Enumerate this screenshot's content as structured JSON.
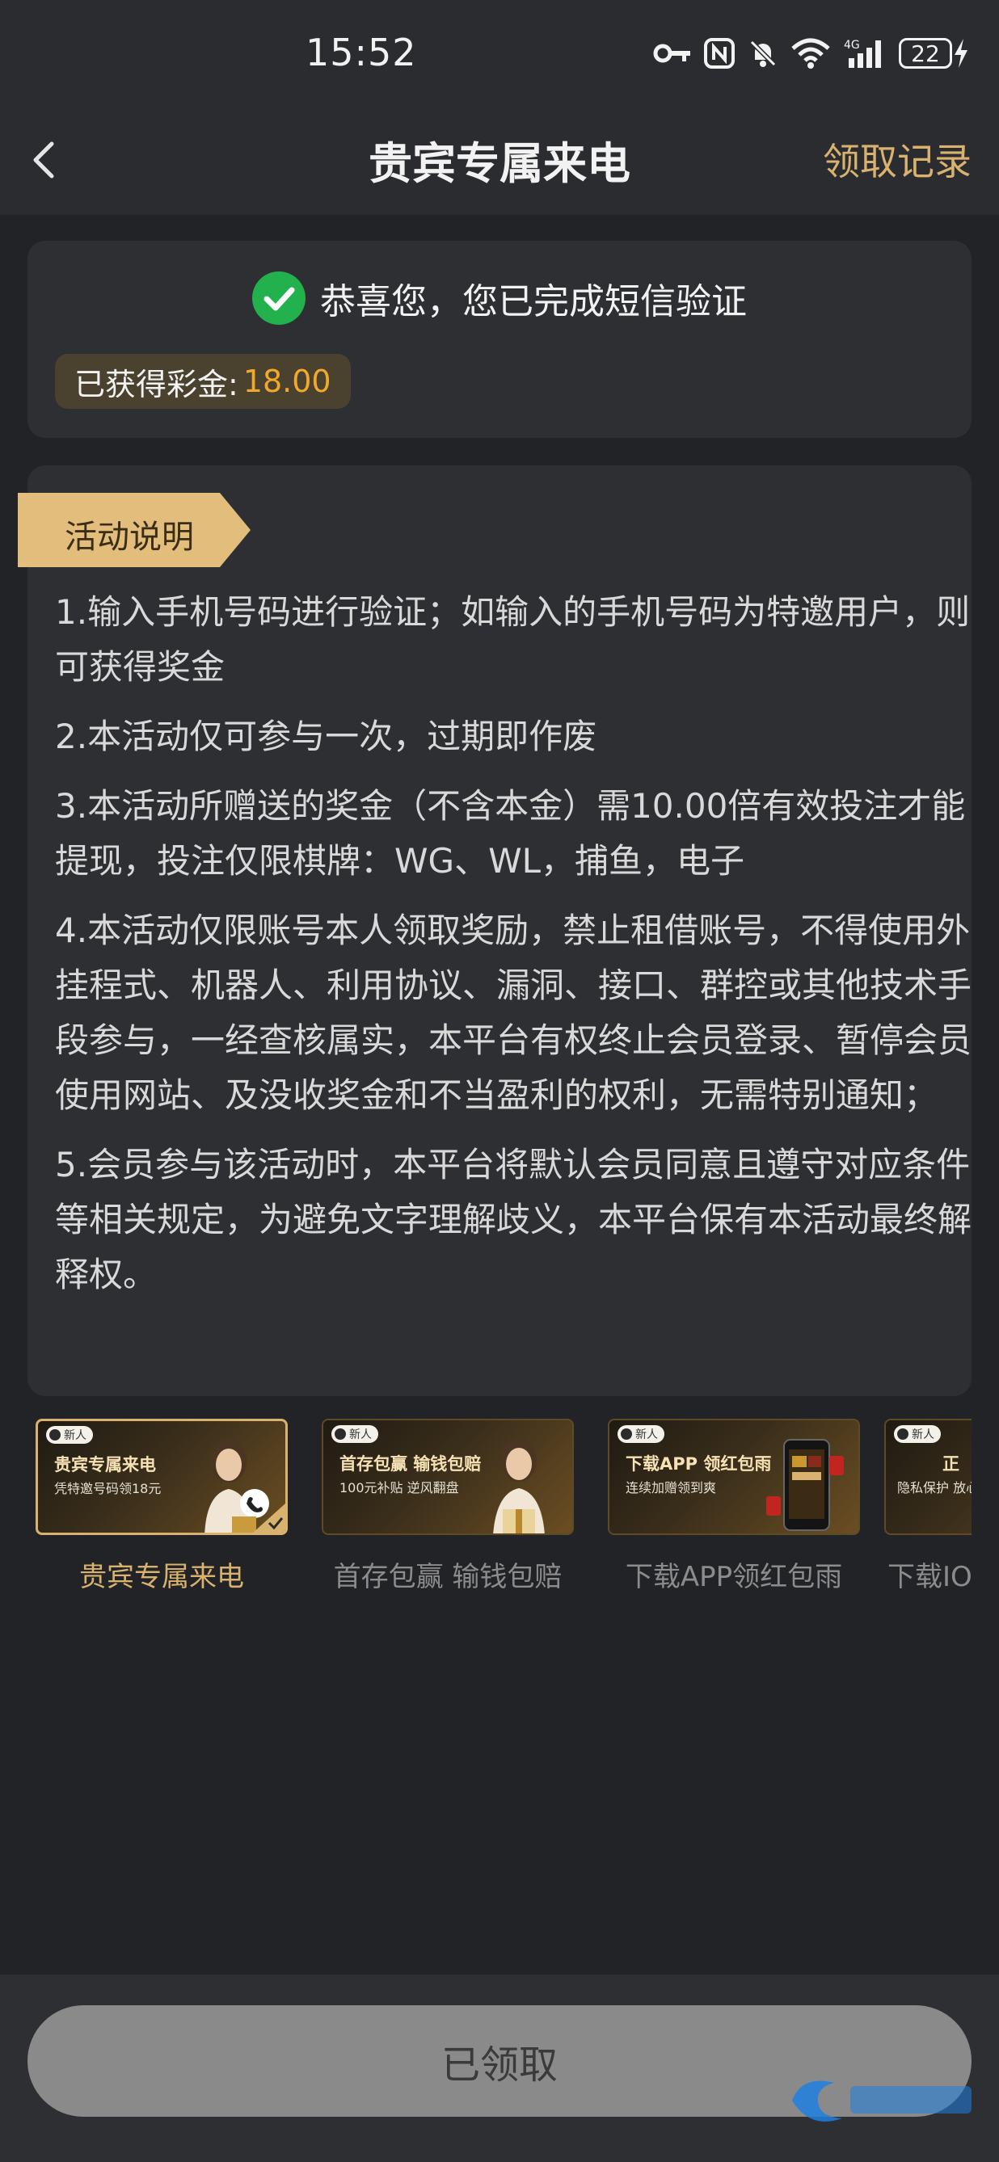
{
  "status_bar": {
    "time": "15:52",
    "battery": "22",
    "network": "4G"
  },
  "nav": {
    "title": "贵宾专属来电",
    "right_link": "领取记录"
  },
  "verify": {
    "message": "恭喜您，您已完成短信验证",
    "reward_label": "已获得彩金:",
    "reward_amount": "18.00"
  },
  "rules": {
    "tag": "活动说明",
    "items": [
      "1.输入手机号码进行验证；如输入的手机号码为特邀用户，则可获得奖金",
      "2.本活动仅可参与一次，过期即作废",
      "3.本活动所赠送的奖金（不含本金）需10.00倍有效投注才能提现，投注仅限棋牌：WG、WL，捕鱼，电子",
      "4.本活动仅限账号本人领取奖励，禁止租借账号，不得使用外挂程式、机器人、利用协议、漏洞、接口、群控或其他技术手段参与，一经查核属实，本平台有权终止会员登录、暂停会员使用网站、及没收奖金和不当盈利的权利，无需特别通知；",
      "5.会员参与该活动时，本平台将默认会员同意且遵守对应条件等相关规定，为避免文字理解歧义，本平台保有本活动最终解释权。"
    ]
  },
  "banners": [
    {
      "badge": "新人",
      "title": "贵宾专属来电",
      "subtitle": "凭特邀号码领18元",
      "label": "贵宾专属来电",
      "active": true
    },
    {
      "badge": "新人",
      "title": "首存包赢 输钱包赔",
      "subtitle": "100元补贴 逆风翻盘",
      "label": "首存包赢 输钱包赔",
      "active": false
    },
    {
      "badge": "新人",
      "title": "下载APP 领红包雨",
      "subtitle": "连续加赠领到爽",
      "label": "下载APP领红包雨",
      "active": false
    },
    {
      "badge": "新人",
      "title": "正",
      "subtitle": "隐私保护 放心",
      "label": "下载IO",
      "active": false
    }
  ],
  "claim_button": "已领取",
  "colors": {
    "accent_gold": "#d8b26e",
    "reward_orange": "#f0a92c",
    "success_green": "#22b14c"
  },
  "icons": [
    "back-arrow-icon",
    "check-circle-icon",
    "key-icon",
    "nfc-icon",
    "bell-off-icon",
    "wifi-icon",
    "signal-icon",
    "battery-icon",
    "charging-icon"
  ]
}
